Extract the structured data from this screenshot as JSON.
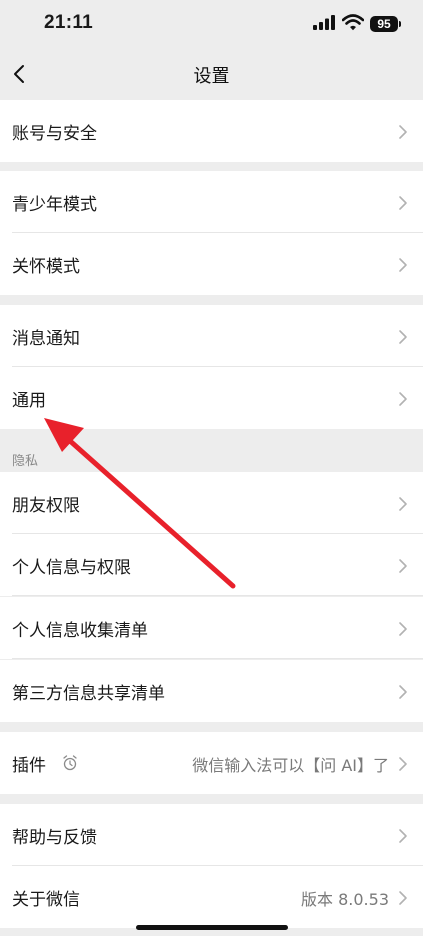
{
  "status_bar": {
    "time": "21:11",
    "battery": "95"
  },
  "nav": {
    "title": "设置"
  },
  "rows": {
    "account_security": "账号与安全",
    "youth_mode": "青少年模式",
    "care_mode": "关怀模式",
    "notifications": "消息通知",
    "general": "通用",
    "friend_permissions": "朋友权限",
    "personal_info_permissions": "个人信息与权限",
    "personal_info_collection": "个人信息收集清单",
    "third_party_sharing": "第三方信息共享清单",
    "plugins": "插件",
    "help_feedback": "帮助与反馈",
    "about_wechat": "关于微信"
  },
  "section_privacy": "隐私",
  "plugin_value": "微信输入法可以【问 AI】了",
  "about_value": "版本 8.0.53",
  "colors": {
    "background": "#ededed",
    "row_background": "#ffffff",
    "annotation_arrow": "#e8212b"
  }
}
